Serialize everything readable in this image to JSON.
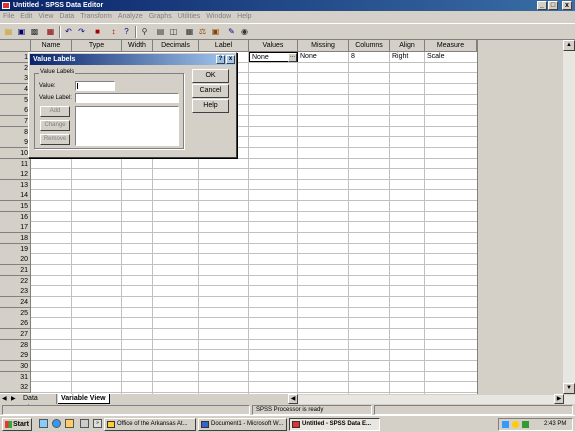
{
  "window": {
    "title": "Untitled - SPSS Data Editor",
    "controls": [
      "_",
      "□",
      "x"
    ]
  },
  "menu": [
    "File",
    "Edit",
    "View",
    "Data",
    "Transform",
    "Analyze",
    "Graphs",
    "Utilities",
    "Window",
    "Help"
  ],
  "toolbar_icons": [
    "open-icon",
    "save-icon",
    "print-icon",
    "dialog-recall-icon",
    "undo-icon",
    "redo-icon",
    "goto-chart-icon",
    "goto-case-icon",
    "variables-icon",
    "find-icon",
    "insert-case-icon",
    "insert-variable-icon",
    "split-file-icon",
    "weight-cases-icon",
    "select-cases-icon",
    "value-labels-icon",
    "use-sets-icon"
  ],
  "grid": {
    "columns": [
      "Name",
      "Type",
      "Width",
      "Decimals",
      "Label",
      "Values",
      "Missing",
      "Columns",
      "Align",
      "Measure"
    ],
    "row_numbers": [
      "1",
      "2",
      "3",
      "4",
      "5",
      "6",
      "7",
      "8",
      "9",
      "10",
      "11",
      "12",
      "13",
      "14",
      "15",
      "16",
      "17",
      "18",
      "19",
      "20",
      "21",
      "22",
      "23",
      "24",
      "25",
      "26",
      "27",
      "28",
      "29",
      "30",
      "31",
      "32"
    ],
    "row1": {
      "values": "None",
      "missing": "None",
      "columns": "8",
      "align": "Right",
      "measure": "Scale"
    }
  },
  "tabs": {
    "data_view": "Data View",
    "variable_view": "Variable View"
  },
  "status": {
    "processor": "SPSS Processor  is ready"
  },
  "taskbar": {
    "start": "Start",
    "tasks": [
      "Office of the Arkansas At...",
      "Document1 - Microsoft W...",
      "Untitled - SPSS Data E..."
    ],
    "time": "2:43 PM"
  },
  "dialog": {
    "title": "Value Labels",
    "help_q": "?",
    "close": "x",
    "group_label": "Value Labels",
    "value_label": "Value:",
    "value_label_label": "Value Label:",
    "value_input": "",
    "label_input": "",
    "add": "Add",
    "change": "Change",
    "remove": "Remove",
    "ok": "OK",
    "cancel": "Cancel",
    "help": "Help"
  }
}
